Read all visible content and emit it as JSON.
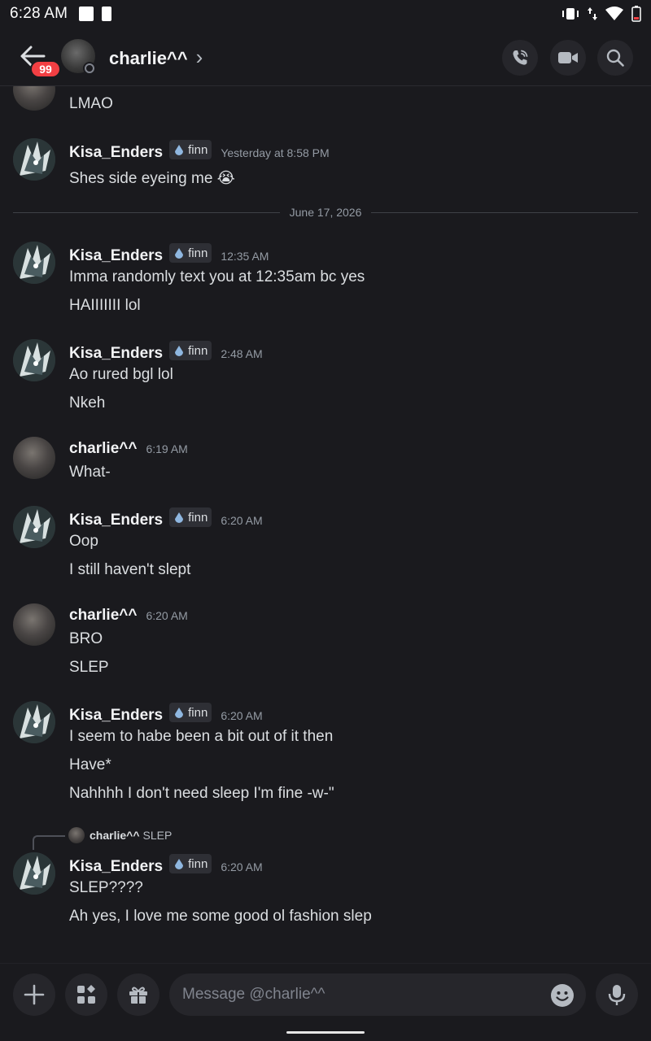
{
  "status_bar": {
    "time": "6:28 AM"
  },
  "header": {
    "back_label": "Back",
    "unread_badge": "99",
    "contact_name": "charlie^^",
    "chevron": "›"
  },
  "composer": {
    "placeholder": "Message @charlie^^"
  },
  "messages": [
    {
      "lines": [
        "LMAO"
      ]
    },
    {
      "user": "Kisa_Enders",
      "tag": "finn",
      "time": "Yesterday at 8:58 PM",
      "lines": [
        "Shes side eyeing me 😭"
      ]
    },
    {
      "divider": "June 17, 2026"
    },
    {
      "user": "Kisa_Enders",
      "tag": "finn",
      "time": "12:35 AM",
      "lines": [
        "Imma randomly text you at 12:35am bc yes",
        "HAIIIIIII lol"
      ]
    },
    {
      "user": "Kisa_Enders",
      "tag": "finn",
      "time": "2:48 AM",
      "lines": [
        "Ao rured bgl lol",
        "Nkeh"
      ]
    },
    {
      "user": "charlie^^",
      "time": "6:19 AM",
      "lines": [
        "What-"
      ]
    },
    {
      "user": "Kisa_Enders",
      "tag": "finn",
      "time": "6:20 AM",
      "lines": [
        "Oop",
        "I still haven't slept"
      ]
    },
    {
      "user": "charlie^^",
      "time": "6:20 AM",
      "lines": [
        "BRO",
        "SLEP"
      ]
    },
    {
      "user": "Kisa_Enders",
      "tag": "finn",
      "time": "6:20 AM",
      "lines": [
        "I seem to habe been a bit out of it then",
        "Have*",
        "Nahhhh I don't need sleep I'm fine -w-\""
      ]
    },
    {
      "reply_user": "charlie^^",
      "reply_text": "SLEP",
      "user": "Kisa_Enders",
      "tag": "finn",
      "time": "6:20 AM",
      "lines": [
        "SLEP????",
        "Ah yes, I love me some good ol fashion slep"
      ]
    }
  ],
  "colors": {
    "background": "#1a1a1e",
    "badge": "#f23f43",
    "text": "#dbdee1",
    "muted": "#949ba4"
  }
}
